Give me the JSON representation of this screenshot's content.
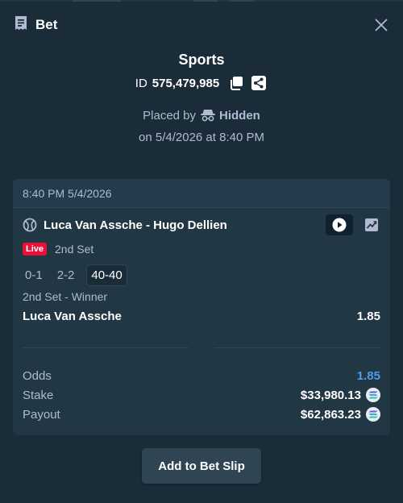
{
  "header": {
    "title": "Bet",
    "icon": "receipt-icon",
    "close_icon": "close-icon"
  },
  "summary": {
    "sport": "Sports",
    "id_prefix": "ID",
    "id_value": "575,479,985",
    "placed_by_label": "Placed by",
    "placed_by_user": "Hidden",
    "placed_on": "on 5/4/2026 at 8:40 PM"
  },
  "bet": {
    "timestamp": "8:40 PM 5/4/2026",
    "event": "Luca Van Assche - Hugo Dellien",
    "live_label": "Live",
    "period": "2nd Set",
    "scores": [
      "0-1",
      "2-2",
      "40-40"
    ],
    "market": "2nd Set - Winner",
    "selection": "Luca Van Assche",
    "selection_odds": "1.85"
  },
  "totals": {
    "odds_label": "Odds",
    "odds_value": "1.85",
    "stake_label": "Stake",
    "stake_value": "$33,980.13",
    "payout_label": "Payout",
    "payout_value": "$62,863.23"
  },
  "actions": {
    "add_to_slip": "Add to Bet Slip"
  },
  "colors": {
    "background": "#1a2c38",
    "card": "#213743",
    "live": "#e9113c",
    "odds_accent": "#4f9de8"
  }
}
